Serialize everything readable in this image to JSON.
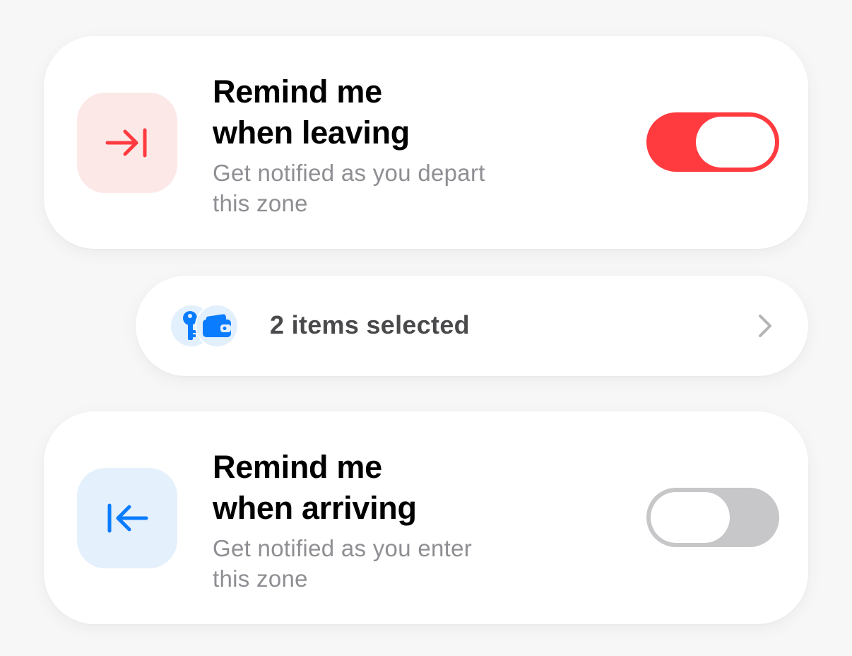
{
  "leaving": {
    "title_line1": "Remind me",
    "title_line2": "when leaving",
    "subtitle_line1": "Get notified as you depart",
    "subtitle_line2": "this zone",
    "icon": "arrow-right-to-line-icon",
    "enabled": true,
    "accent_color": "#ff3b40"
  },
  "items": {
    "label": "2 items selected",
    "icons": [
      "key-icon",
      "wallet-icon"
    ],
    "accent_color": "#0a7cff"
  },
  "arriving": {
    "title_line1": "Remind me",
    "title_line2": "when arriving",
    "subtitle_line1": "Get notified as you enter",
    "subtitle_line2": "this zone",
    "icon": "arrow-left-from-line-icon",
    "enabled": false,
    "accent_color": "#0a7cff"
  }
}
